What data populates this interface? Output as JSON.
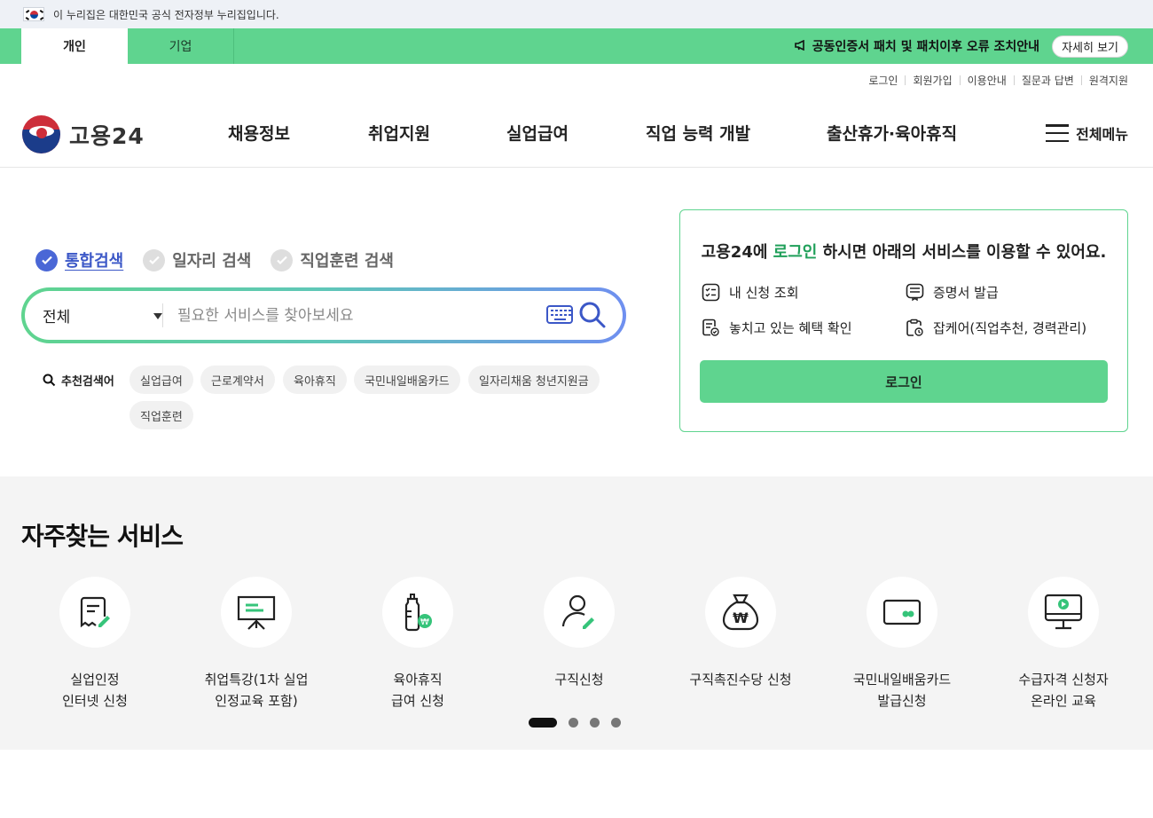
{
  "gov_banner": {
    "text": "이 누리집은 대한민국 공식 전자정부 누리집입니다."
  },
  "user_tabs": {
    "personal": "개인",
    "business": "기업"
  },
  "notice": {
    "text": "공동인증서 패치 및 패치이후 오류 조치안내",
    "button": "자세히 보기"
  },
  "util_links": [
    "로그인",
    "회원가입",
    "이용안내",
    "질문과 답변",
    "원격지원"
  ],
  "logo": {
    "text": "고용24"
  },
  "gnb": [
    "채용정보",
    "취업지원",
    "실업급여",
    "직업 능력 개발",
    "출산휴가·육아휴직"
  ],
  "all_menu": "전체메뉴",
  "search_types": [
    "통합검색",
    "일자리 검색",
    "직업훈련 검색"
  ],
  "search": {
    "select_value": "전체",
    "placeholder": "필요한 서비스를 찾아보세요",
    "value": ""
  },
  "recommended": {
    "label": "추천검색어",
    "chips": [
      "실업급여",
      "근로계약서",
      "육아휴직",
      "국민내일배움카드",
      "일자리채움 청년지원금",
      "직업훈련"
    ]
  },
  "login_card": {
    "title_pre": "고용24에 ",
    "title_hl": "로그인",
    "title_post": " 하시면 아래의 서비스를 이용할 수 있어요.",
    "services": [
      "내 신청 조회",
      "증명서 발급",
      "놓치고 있는 혜택 확인",
      "잡케어(직업추천, 경력관리)"
    ],
    "button": "로그인"
  },
  "frequent": {
    "title": "자주찾는 서비스",
    "items": [
      {
        "label": "실업인정\n인터넷 신청",
        "icon": "document-edit-icon"
      },
      {
        "label": "취업특강(1차 실업\n인정교육 포함)",
        "icon": "presentation-board-icon"
      },
      {
        "label": "육아휴직\n급여 신청",
        "icon": "baby-bottle-icon"
      },
      {
        "label": "구직신청",
        "icon": "person-edit-icon"
      },
      {
        "label": "구직촉진수당 신청",
        "icon": "money-bag-icon"
      },
      {
        "label": "국민내일배움카드\n발급신청",
        "icon": "card-icon"
      },
      {
        "label": "수급자격 신청자\n온라인 교육",
        "icon": "monitor-play-icon"
      }
    ],
    "page": 1,
    "pages": 4
  },
  "colors": {
    "accent_green": "#5fd48f",
    "accent_blue": "#3b57c7"
  }
}
